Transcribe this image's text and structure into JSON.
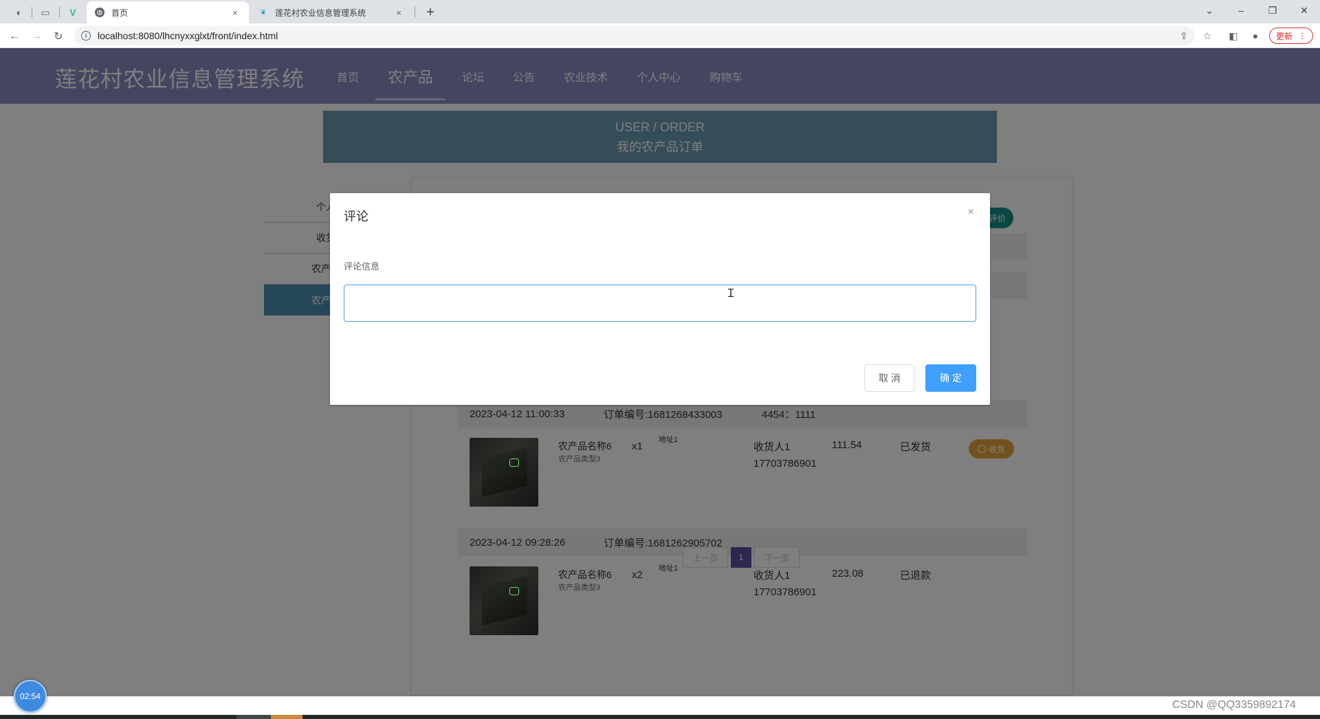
{
  "browser": {
    "tabs": [
      {
        "title": "首页",
        "close": "×"
      },
      {
        "title": "莲花村农业信息管理系统",
        "close": "×"
      }
    ],
    "new_tab": "+",
    "url": "localhost:8080/lhcnyxxglxt/front/index.html",
    "update_label": "更新",
    "window_controls": {
      "minimize": "–",
      "maximize": "❐",
      "close": "✕"
    }
  },
  "site": {
    "title": "莲花村农业信息管理系统",
    "nav": [
      {
        "label": "首页",
        "active": false
      },
      {
        "label": "农产品",
        "active": true
      },
      {
        "label": "论坛",
        "active": false
      },
      {
        "label": "公告",
        "active": false
      },
      {
        "label": "农业技术",
        "active": false
      },
      {
        "label": "个人中心",
        "active": false
      },
      {
        "label": "购物车",
        "active": false
      }
    ]
  },
  "banner": {
    "en": "USER / ORDER",
    "cn": "我的农产品订单"
  },
  "side_menu": [
    "个人",
    "收货",
    "农产品",
    "农产品"
  ],
  "orders": [
    {
      "time": "2023-04-12 11:00:33",
      "order_no": "订单编号:1681268433003",
      "extra": "4454：1111",
      "product_name": "农产品名称6",
      "product_type": "农产品类型3",
      "qty": "x1",
      "address": "地址1",
      "receiver": "收货人1",
      "phone": "17703786901",
      "price": "111.54",
      "status": "已发货",
      "action": "收货"
    },
    {
      "time": "2023-04-12 09:28:26",
      "order_no": "订单编号:1681262905702",
      "extra": "",
      "product_name": "农产品名称6",
      "product_type": "农产品类型3",
      "qty": "x2",
      "address": "地址1",
      "receiver": "收货人1",
      "phone": "17703786901",
      "price": "223.08",
      "status": "已退款",
      "action": ""
    }
  ],
  "review_button": "评价",
  "pager": {
    "prev": "上一页",
    "current": "1",
    "next": "下一页"
  },
  "dialog": {
    "title": "评论",
    "field_label": "评论信息",
    "comment_value": "",
    "cancel": "取 消",
    "confirm": "确 定",
    "close": "×"
  },
  "timer": "02:54",
  "watermark": "CSDN @QQ3359892174"
}
